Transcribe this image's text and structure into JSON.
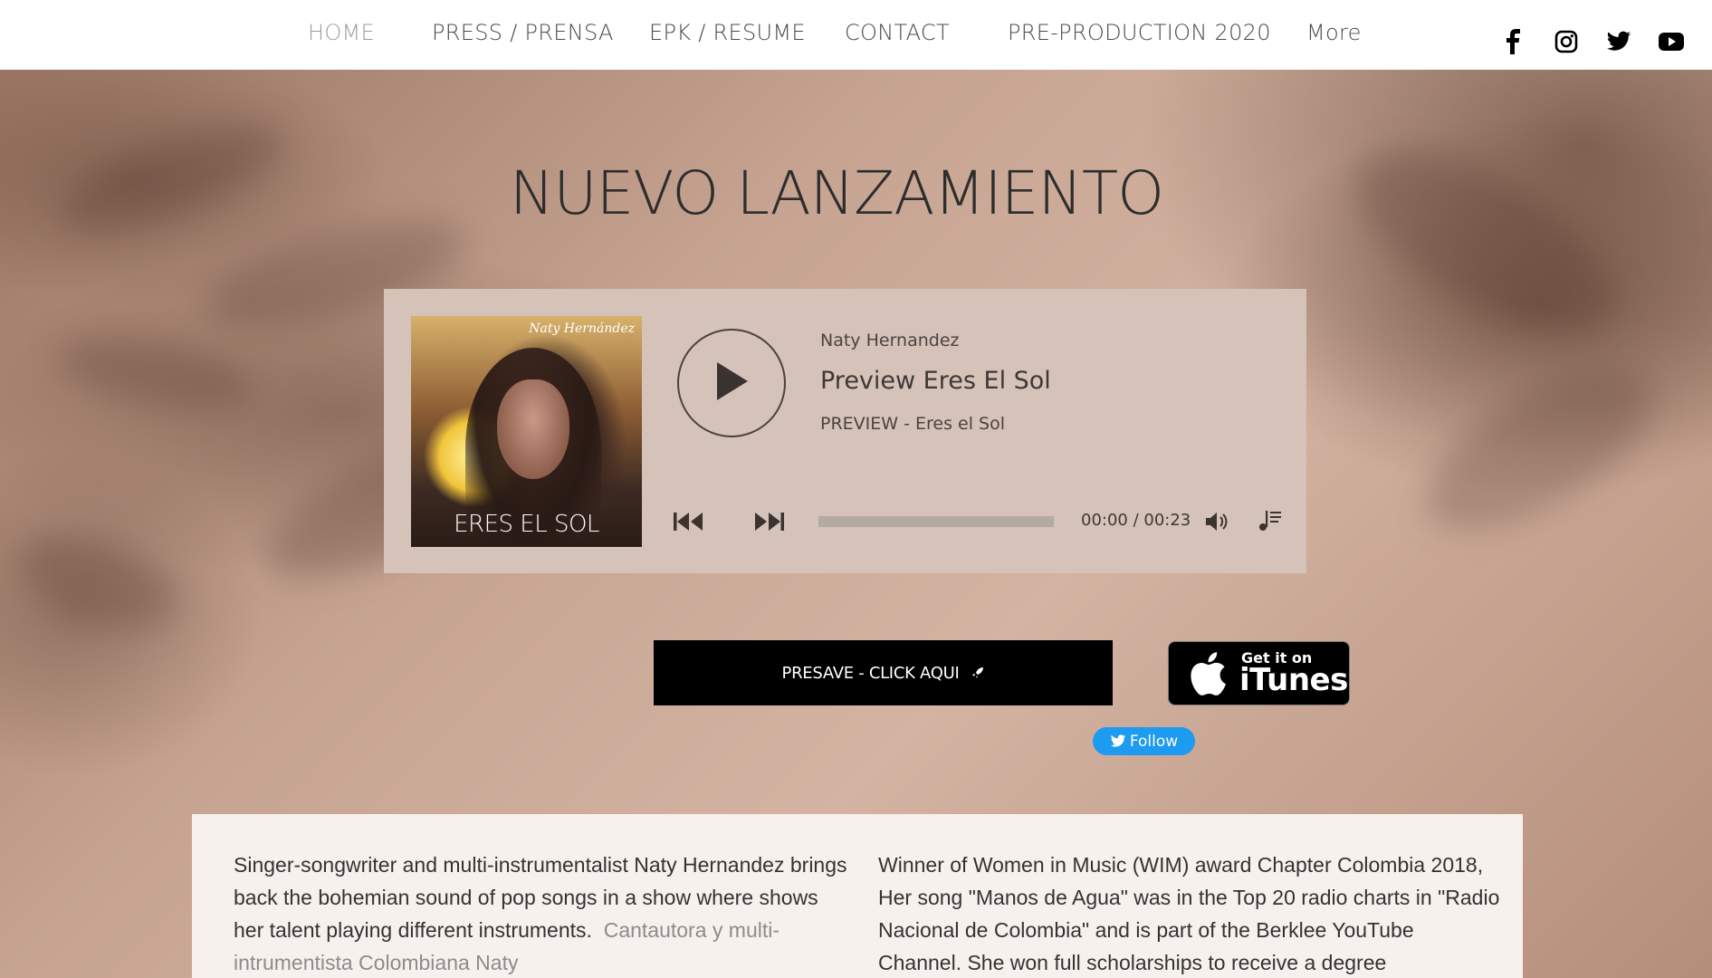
{
  "nav": {
    "items": [
      "HOME",
      "PRESS / PRENSA",
      "EPK / RESUME",
      "CONTACT",
      "PRE-PRODUCTION 2020",
      "More"
    ],
    "active": "HOME",
    "social": [
      "facebook-icon",
      "instagram-icon",
      "twitter-icon",
      "youtube-icon"
    ]
  },
  "headline": "NUEVO LANZAMIENTO",
  "player": {
    "cover_signature": "Naty Hernández",
    "cover_title": "ERES EL SOL",
    "artist": "Naty Hernandez",
    "title": "Preview Eres El Sol",
    "subtitle": "PREVIEW - Eres el Sol",
    "time": "00:00 / 00:23",
    "progress": 0
  },
  "presave": {
    "label": "PRESAVE - CLICK AQUI",
    "icon": "rocket-icon"
  },
  "itunes": {
    "small": "Get it on",
    "big": "iTunes"
  },
  "follow": {
    "label": "Follow"
  },
  "about": {
    "col1_en": "Singer-songwriter and multi-instrumentalist Naty Hernandez brings back the bohemian sound of pop songs in a show where shows her talent playing different instruments.",
    "col1_es": "Cantautora y multi-intrumentista Colombiana Naty",
    "col2": "Winner of Women in Music (WIM) award Chapter Colombia 2018, Her song \"Manos de Agua\" was in the Top 20 radio charts in \"Radio Nacional de Colombia\" and is part of the Berklee YouTube Channel. She won full scholarships to receive a degree"
  },
  "colors": {
    "nav_bg": "#ffffff",
    "player_bg": "#d5c2b9",
    "presave_bg": "#000000",
    "follow_bg": "#1d9bf0",
    "panel_bg": "#f7f1ee"
  }
}
